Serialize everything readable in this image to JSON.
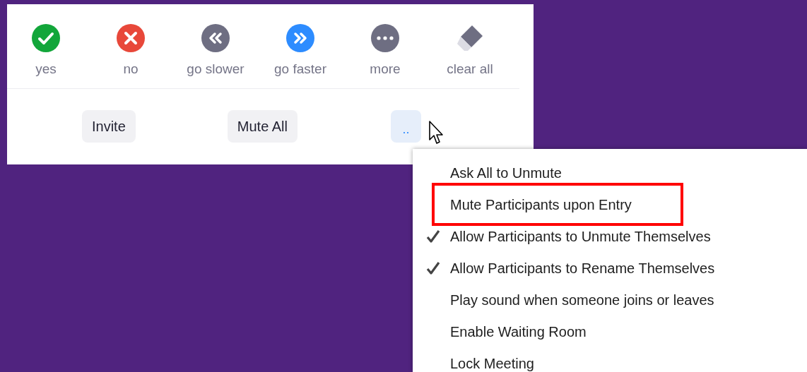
{
  "reactions": [
    {
      "kind": "yes",
      "label": "yes"
    },
    {
      "kind": "no",
      "label": "no"
    },
    {
      "kind": "slower",
      "label": "go slower"
    },
    {
      "kind": "faster",
      "label": "go faster"
    },
    {
      "kind": "more",
      "label": "more"
    },
    {
      "kind": "clear",
      "label": "clear all"
    }
  ],
  "buttons": [
    {
      "label": "Invite"
    },
    {
      "label": "Mute All"
    }
  ],
  "more_button": {
    "label": ".."
  },
  "menu": [
    {
      "label": "Ask All to Unmute",
      "checked": false,
      "highlighted": false
    },
    {
      "label": "Mute Participants upon Entry",
      "checked": false,
      "highlighted": true
    },
    {
      "label": "Allow Participants to Unmute Themselves",
      "checked": true,
      "highlighted": false
    },
    {
      "label": "Allow Participants to Rename Themselves",
      "checked": true,
      "highlighted": false
    },
    {
      "label": "Play sound when someone joins or leaves",
      "checked": false,
      "highlighted": false
    },
    {
      "label": "Enable Waiting Room",
      "checked": false,
      "highlighted": false
    },
    {
      "label": "Lock Meeting",
      "checked": false,
      "highlighted": false
    }
  ]
}
